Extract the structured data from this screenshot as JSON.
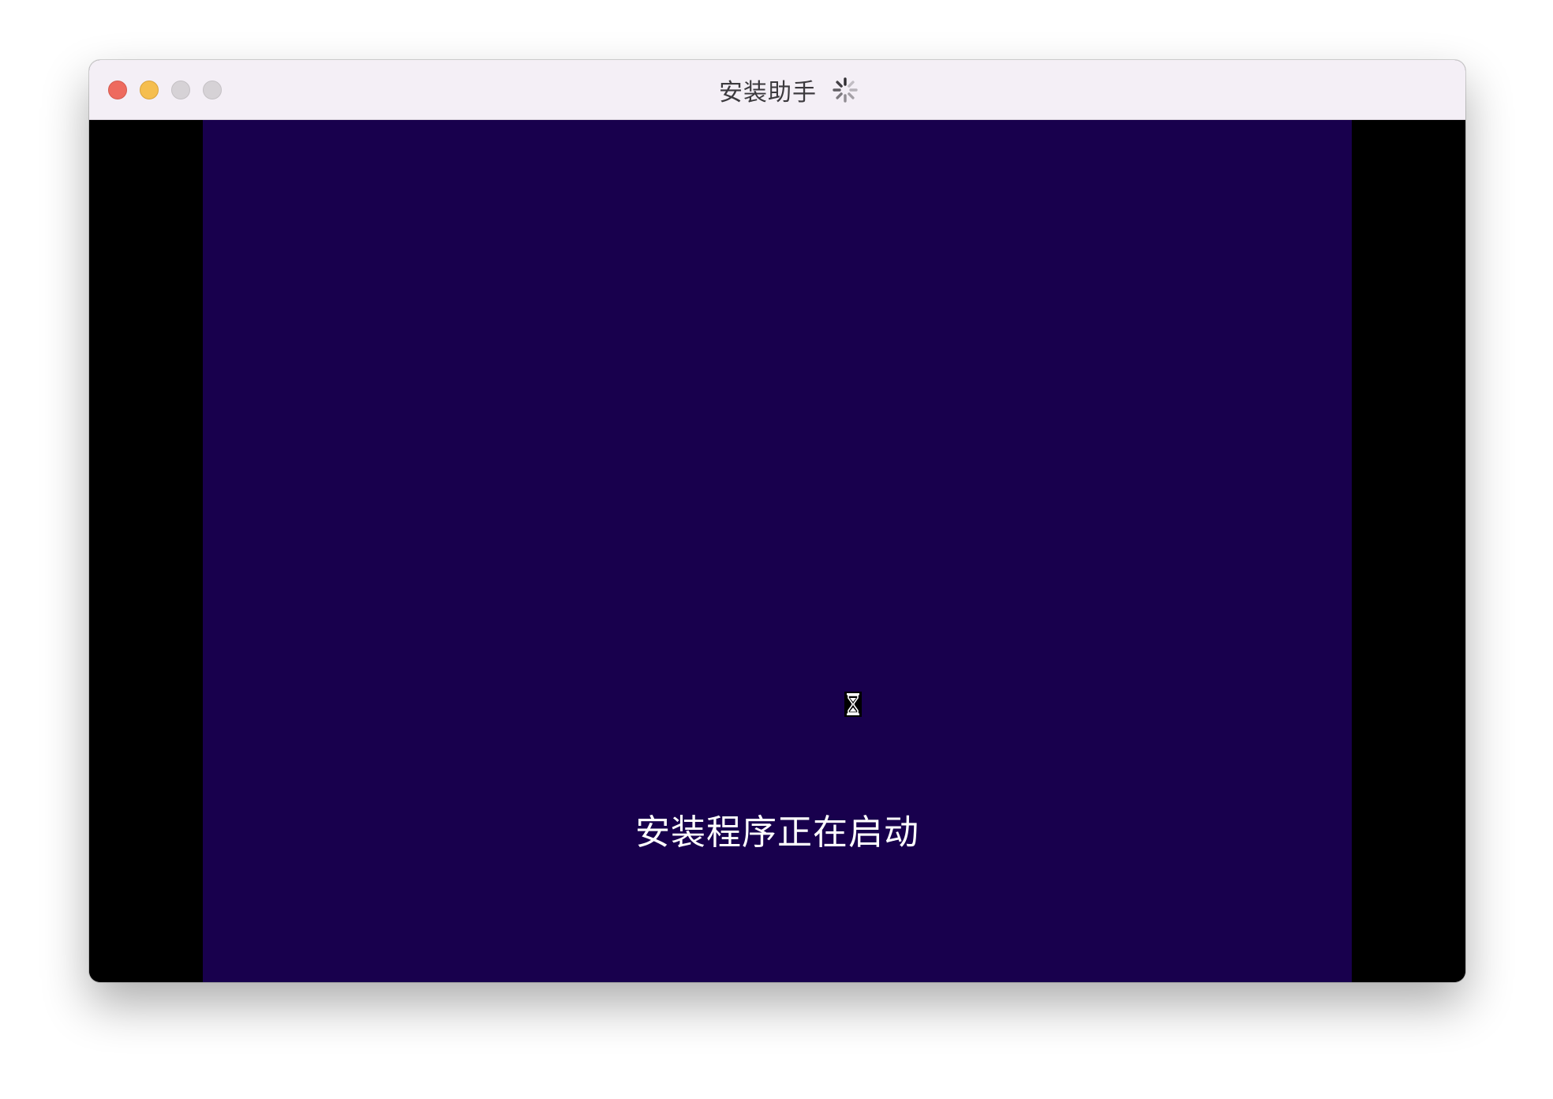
{
  "window": {
    "title": "安装助手"
  },
  "installer": {
    "status_text": "安装程序正在启动",
    "background_color": "#18004d"
  },
  "icons": {
    "title_spinner": "loading-spinner-icon",
    "cursor": "hourglass-cursor-icon"
  },
  "colors": {
    "traffic_close": "#ee6a5e",
    "traffic_minimize": "#f5be4f",
    "traffic_disabled": "#d6d2d6",
    "titlebar": "#f4eff6",
    "letterbox": "#000000"
  }
}
